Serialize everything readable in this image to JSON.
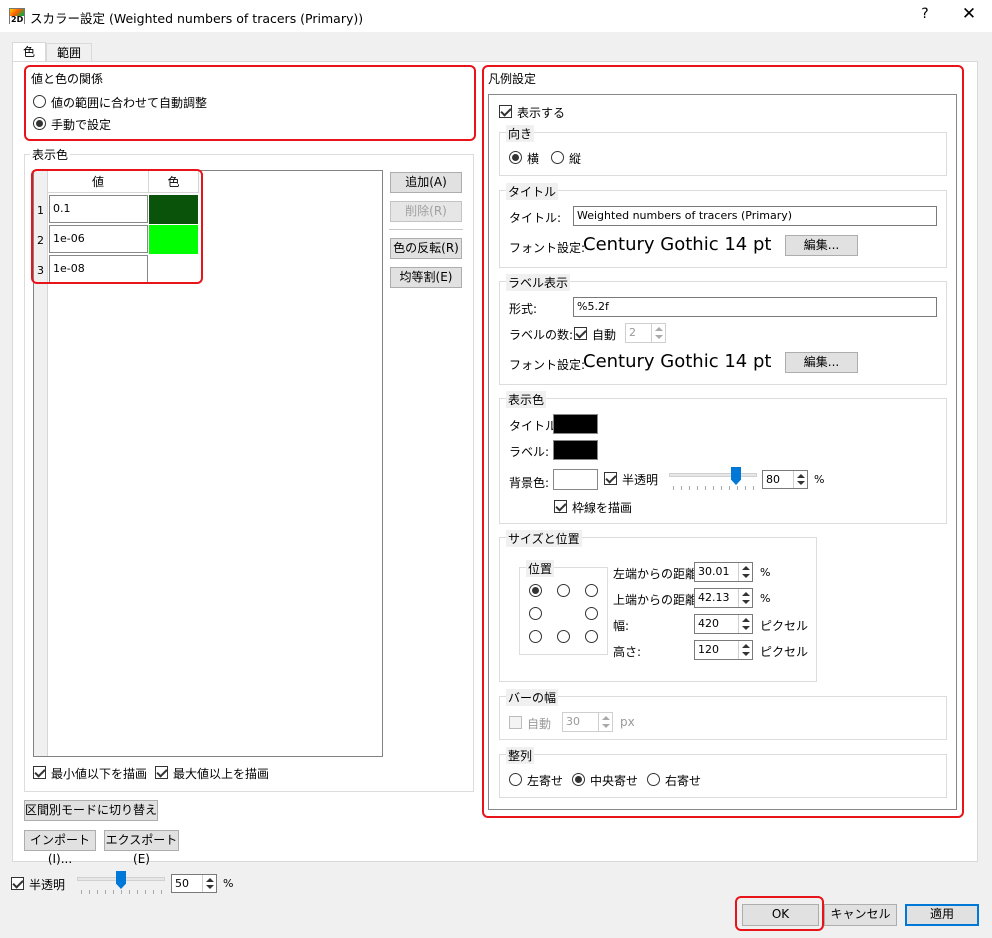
{
  "window": {
    "title": "スカラー設定 (Weighted numbers of tracers (Primary))",
    "app_icon_text": "2D",
    "help_label": "?",
    "close_label": "✕"
  },
  "tabs": [
    "色",
    "範囲"
  ],
  "value_color_relation": {
    "title": "値と色の関係",
    "options": [
      "値の範囲に合わせて自動調整",
      "手動で設定"
    ],
    "selected": 1
  },
  "display_color": {
    "title": "表示色",
    "table": {
      "headers": [
        "値",
        "色"
      ],
      "rows": [
        {
          "index": "1",
          "value": "0.1",
          "color": "#0a530a"
        },
        {
          "index": "2",
          "value": "1e-06",
          "color": "#00ff00"
        },
        {
          "index": "3",
          "value": "1e-08",
          "color": "#ffffff"
        }
      ]
    },
    "buttons": {
      "add": "追加(A)",
      "delete": "削除(R)",
      "reverse": "色の反転(R)",
      "equal_split": "均等割(E)"
    },
    "draw_below_min": "最小値以下を描画",
    "draw_above_max": "最大値以上を描画"
  },
  "left_buttons": {
    "interval_mode": "区間別モードに切り替え",
    "import": "インポート(I)...",
    "export": "エクスポート(E)"
  },
  "legend": {
    "title": "凡例設定",
    "show_label": "表示する",
    "show_checked": true,
    "orientation": {
      "title": "向き",
      "options": [
        "横",
        "縦"
      ],
      "selected": 0
    },
    "title_section": {
      "title": "タイトル",
      "title_label": "タイトル:",
      "title_value": "Weighted numbers of tracers (Primary)",
      "font_label": "フォント設定:",
      "font_value": "Century Gothic 14 pt",
      "edit_button": "編集..."
    },
    "label_section": {
      "title": "ラベル表示",
      "format_label": "形式:",
      "format_value": "%5.2f",
      "count_label": "ラベルの数:",
      "auto_label": "自動",
      "auto_checked": true,
      "count_value": "2",
      "font_label": "フォント設定:",
      "font_value": "Century Gothic 14 pt",
      "edit_button": "編集..."
    },
    "color_section": {
      "title": "表示色",
      "title_label": "タイトル:",
      "title_color": "#000000",
      "label_label": "ラベル:",
      "label_color": "#000000",
      "bg_label": "背景色:",
      "bg_color": "#ffffff",
      "transparent_label": "半透明",
      "transparent_checked": true,
      "transparency_value": "80",
      "transparency_fraction": 0.8,
      "percent": "%",
      "border_label": "枠線を描画",
      "border_checked": true
    },
    "size_position": {
      "title": "サイズと位置",
      "position_title": "位置",
      "selected_position": "top-left",
      "left_label": "左端からの距離",
      "left_value": "30.01",
      "top_label": "上端からの距離",
      "top_value": "42.13",
      "width_label": "幅:",
      "width_value": "420",
      "height_label": "高さ:",
      "height_value": "120",
      "percent": "%",
      "pixel_unit": "ピクセル"
    },
    "bar_width": {
      "title": "バーの幅",
      "auto_label": "自動",
      "value": "30",
      "unit": "px"
    },
    "alignment": {
      "title": "整列",
      "options": [
        "左寄せ",
        "中央寄せ",
        "右寄せ"
      ],
      "selected": 1
    }
  },
  "bottom": {
    "transparent_label": "半透明",
    "transparent_checked": true,
    "transparency_value": "50",
    "transparency_fraction": 0.5,
    "percent": "%"
  },
  "dialog_buttons": {
    "ok": "OK",
    "cancel": "キャンセル",
    "apply": "適用"
  },
  "colors": {
    "highlight_red": "#e8141a",
    "accent_blue": "#0078d7"
  }
}
